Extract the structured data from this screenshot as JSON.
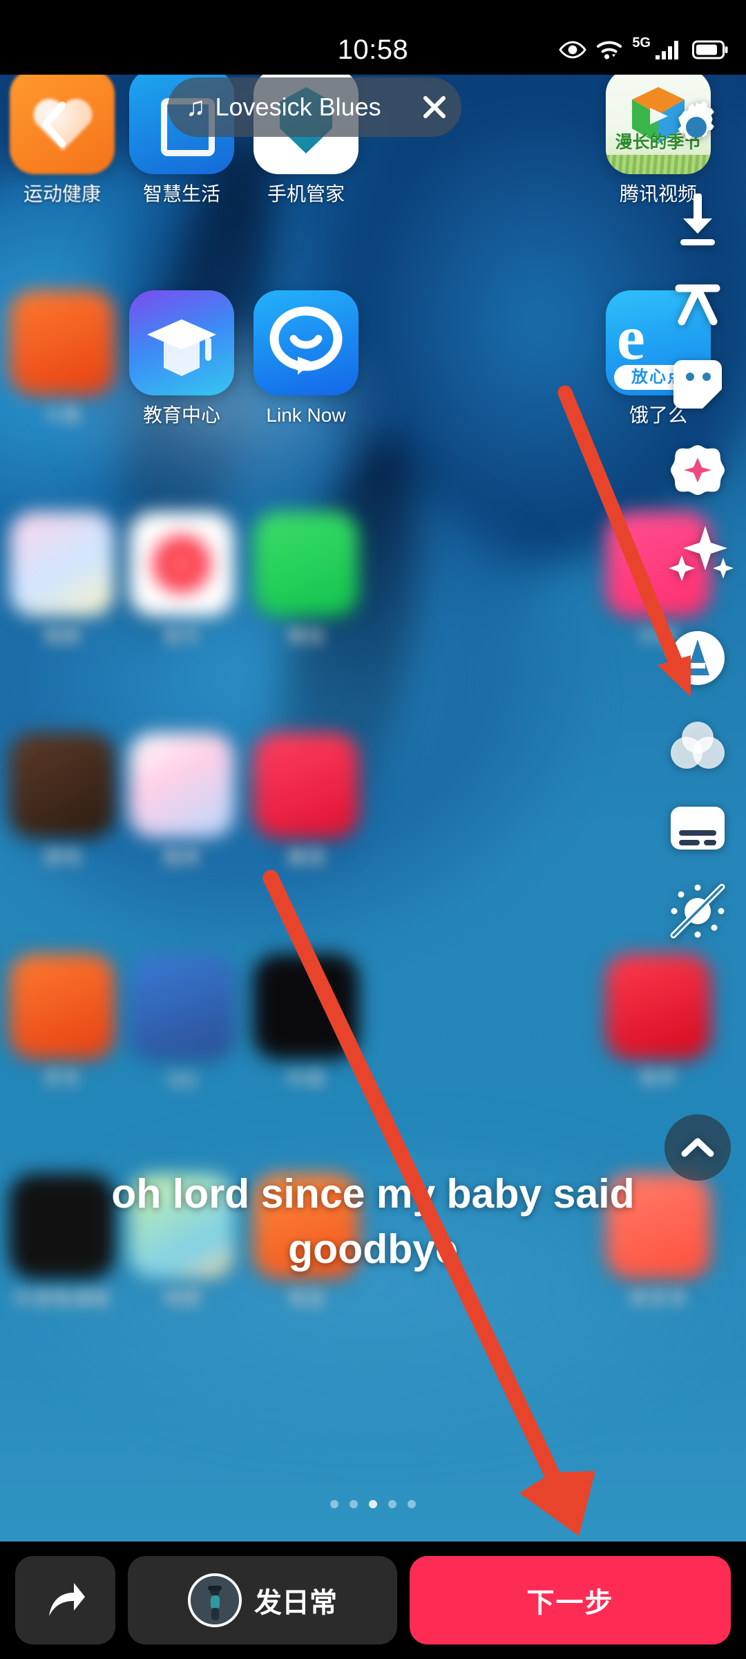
{
  "status_bar": {
    "time": "10:58",
    "network_label": "5G",
    "icons": [
      "eye-care-icon",
      "wifi-icon",
      "signal-bars-icon",
      "battery-icon"
    ]
  },
  "music_banner": {
    "note_glyph": "♫",
    "title": "Lovesick Blues",
    "close_glyph": "✕"
  },
  "back_button": {
    "label": "‹"
  },
  "home_screen": {
    "rows": [
      [
        {
          "label": "运动健康",
          "icon": "health-app-icon",
          "blur": "soft"
        },
        {
          "label": "智慧生活",
          "icon": "smart-life-app-icon",
          "blur": "none"
        },
        {
          "label": "手机管家",
          "icon": "phone-manager-app-icon",
          "blur": "none"
        },
        {
          "label": "腾讯视频",
          "icon": "tencent-video-app-icon",
          "blur": "none"
        }
      ],
      [
        {
          "label": "斗鱼",
          "icon": "douyu-app-icon",
          "blur": "heavy"
        },
        {
          "label": "教育中心",
          "icon": "education-center-app-icon",
          "blur": "none"
        },
        {
          "label": "Link Now",
          "icon": "link-now-app-icon",
          "blur": "none"
        },
        {
          "label": "饿了么",
          "icon": "eleme-app-icon",
          "blur": "none"
        }
      ],
      [
        {
          "label": "相册",
          "icon": "gallery-app-icon",
          "blur": "heavy"
        },
        {
          "label": "音乐",
          "icon": "music-app-icon",
          "blur": "heavy"
        },
        {
          "label": "微信",
          "icon": "wechat-app-icon",
          "blur": "heavy"
        },
        {
          "label": "抖音",
          "icon": "douyin-app-icon",
          "blur": "heavy"
        }
      ],
      [
        {
          "label": "游戏",
          "icon": "game-app-icon",
          "blur": "heavy"
        },
        {
          "label": "图库",
          "icon": "photos-app-icon",
          "blur": "heavy"
        },
        {
          "label": "美团",
          "icon": "meituan-app-icon",
          "blur": "heavy"
        },
        {
          "label": "",
          "icon": "empty-slot",
          "blur": "heavy"
        }
      ],
      [
        {
          "label": "京东",
          "icon": "jd-app-icon",
          "blur": "heavy"
        },
        {
          "label": "QQ",
          "icon": "qq-app-icon",
          "blur": "heavy"
        },
        {
          "label": "抖音",
          "icon": "tiktok-app-icon",
          "blur": "heavy"
        },
        {
          "label": "快手",
          "icon": "kuaishou-app-icon",
          "blur": "heavy"
        }
      ],
      [
        {
          "label": "抖音极速版",
          "icon": "tiktok-lite-app-icon",
          "blur": "heavy"
        },
        {
          "label": "地图",
          "icon": "maps-app-icon",
          "blur": "heavy"
        },
        {
          "label": "淘宝",
          "icon": "taobao-app-icon",
          "blur": "heavy"
        },
        {
          "label": "拼多多",
          "icon": "pinduoduo-app-icon",
          "blur": "heavy"
        }
      ]
    ],
    "page_dots": {
      "count": 5,
      "active_index": 2
    }
  },
  "tool_rail": [
    {
      "name": "settings-gear-icon",
      "label": "设置"
    },
    {
      "name": "download-icon",
      "label": "下载"
    },
    {
      "name": "text-icon",
      "label": "文字"
    },
    {
      "name": "sticker-icon",
      "label": "贴纸"
    },
    {
      "name": "beautify-icon",
      "label": "美化"
    },
    {
      "name": "sparkles-icon",
      "label": "特效"
    },
    {
      "name": "auto-enhance-a-icon",
      "label": "自动"
    },
    {
      "name": "filter-icon",
      "label": "滤镜"
    },
    {
      "name": "captions-icon",
      "label": "字幕"
    },
    {
      "name": "enhance-off-icon",
      "label": "增强关闭"
    },
    {
      "name": "collapse-chevron-up-icon",
      "label": "收起"
    }
  ],
  "lyric_caption": {
    "text": "oh lord since my baby said goodbye"
  },
  "bottom_bar": {
    "share_button": {
      "name": "share-arrow-icon",
      "label": "分享"
    },
    "daily_button": {
      "label": "发日常"
    },
    "next_button": {
      "label": "下一步"
    }
  },
  "annotations": {
    "arrow_1": {
      "target": "sparkles-icon",
      "color": "#e8442c"
    },
    "arrow_2": {
      "target": "next-button",
      "color": "#e8442c"
    }
  },
  "colors": {
    "accent_red": "#fe2c55",
    "annotation_red": "#e8442c",
    "bar_dark": "#2b2b2b",
    "background_black": "#000000"
  }
}
